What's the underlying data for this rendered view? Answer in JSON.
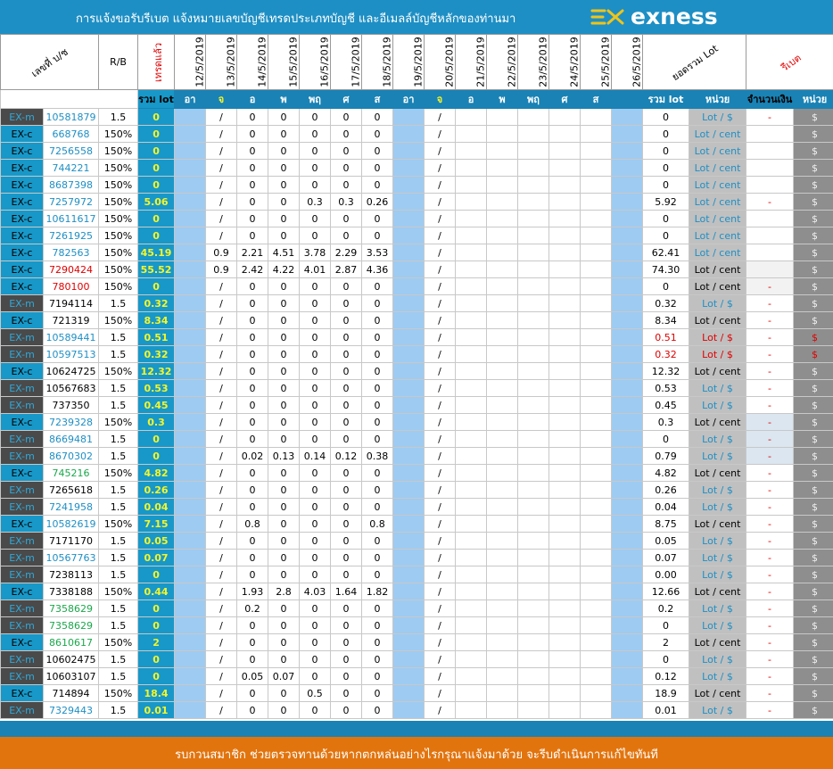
{
  "banner": {
    "title": "การแจ้งขอรับรีเบต   แจ้งหมายเลขบัญชีเทรดประเภทบัญชี และอีเมลล์บัญชีหลักของท่านมา",
    "brand": "exness",
    "logo_icon": "exness-ex-mark-icon"
  },
  "header": {
    "account_label": "เลขที่ บ/ช",
    "rb_label": "R/B",
    "traded_label": "เทรดแล้ว",
    "dates": [
      "12/5/2019",
      "13/5/2019",
      "14/5/2019",
      "15/5/2019",
      "16/5/2019",
      "17/5/2019",
      "18/5/2019",
      "19/5/2019",
      "20/5/2019",
      "21/5/2019",
      "22/5/2019",
      "23/5/2019",
      "24/5/2019",
      "25/5/2019",
      "26/5/2019"
    ],
    "sum_lot_label": "ยอดรวม Lot",
    "rebate_label": "รีเบต"
  },
  "subheader": {
    "total_lot": "รวม lot",
    "days": [
      "อา",
      "จ",
      "อ",
      "พ",
      "พฤ",
      "ศ",
      "ส",
      "อา",
      "จ",
      "อ",
      "พ",
      "พฤ",
      "ศ",
      "ส",
      ""
    ],
    "total_lot2": "รวม lot",
    "unit": "หน่วย",
    "amount": "จำนวนเงิน",
    "unit2": "หน่วย"
  },
  "rows": [
    {
      "type": "EX-m",
      "acc": "10581879",
      "rb": "1.5",
      "total": "0",
      "w1": [
        "/",
        "0",
        "0",
        "0",
        "0",
        "0"
      ],
      "w2": [
        "/"
      ],
      "sum": "0",
      "unit": "Lot / $",
      "amount": "-",
      "cur": "$"
    },
    {
      "type": "EX-c",
      "acc": "668768",
      "rb": "150%",
      "total": "0",
      "w1": [
        "/",
        "0",
        "0",
        "0",
        "0",
        "0"
      ],
      "w2": [
        "/"
      ],
      "sum": "0",
      "unit": "Lot / cent",
      "amount": "",
      "cur": "$"
    },
    {
      "type": "EX-c",
      "acc": "7256558",
      "rb": "150%",
      "total": "0",
      "w1": [
        "/",
        "0",
        "0",
        "0",
        "0",
        "0"
      ],
      "w2": [
        "/"
      ],
      "sum": "0",
      "unit": "Lot / cent",
      "amount": "",
      "cur": "$"
    },
    {
      "type": "EX-c",
      "acc": "744221",
      "rb": "150%",
      "total": "0",
      "w1": [
        "/",
        "0",
        "0",
        "0",
        "0",
        "0"
      ],
      "w2": [
        "/"
      ],
      "sum": "0",
      "unit": "Lot / cent",
      "amount": "",
      "cur": "$"
    },
    {
      "type": "EX-c",
      "acc": "8687398",
      "rb": "150%",
      "total": "0",
      "w1": [
        "/",
        "0",
        "0",
        "0",
        "0",
        "0"
      ],
      "w2": [
        "/"
      ],
      "sum": "0",
      "unit": "Lot / cent",
      "amount": "",
      "cur": "$"
    },
    {
      "type": "EX-c",
      "acc": "7257972",
      "rb": "150%",
      "total": "5.06",
      "w1": [
        "/",
        "0",
        "0",
        "0.3",
        "0.3",
        "0.26"
      ],
      "w2": [
        "/"
      ],
      "sum": "5.92",
      "unit": "Lot / cent",
      "amount": "-",
      "cur": "$"
    },
    {
      "type": "EX-c",
      "acc": "10611617",
      "rb": "150%",
      "total": "0",
      "w1": [
        "/",
        "0",
        "0",
        "0",
        "0",
        "0"
      ],
      "w2": [
        "/"
      ],
      "sum": "0",
      "unit": "Lot / cent",
      "amount": "",
      "cur": "$"
    },
    {
      "type": "EX-c",
      "acc": "7261925",
      "rb": "150%",
      "total": "0",
      "w1": [
        "/",
        "0",
        "0",
        "0",
        "0",
        "0"
      ],
      "w2": [
        "/"
      ],
      "sum": "0",
      "unit": "Lot / cent",
      "amount": "",
      "cur": "$"
    },
    {
      "type": "EX-c",
      "acc": "782563",
      "rb": "150%",
      "total": "45.19",
      "w1": [
        "0.9",
        "2.21",
        "4.51",
        "3.78",
        "2.29",
        "3.53"
      ],
      "w2": [
        "/"
      ],
      "sum": "62.41",
      "unit": "Lot / cent",
      "amount": "",
      "cur": "$"
    },
    {
      "type": "EX-c",
      "acc": "7290424",
      "rb": "150%",
      "total": "55.52",
      "w1": [
        "0.9",
        "2.42",
        "4.22",
        "4.01",
        "2.87",
        "4.36"
      ],
      "w2": [
        "/"
      ],
      "sum": "74.30",
      "unit": "Lot / cent",
      "amount": "",
      "cur": "$"
    },
    {
      "type": "EX-c",
      "acc": "780100",
      "rb": "150%",
      "total": "0",
      "w1": [
        "/",
        "0",
        "0",
        "0",
        "0",
        "0"
      ],
      "w2": [
        "/"
      ],
      "sum": "0",
      "unit": "Lot / cent",
      "amount": "-",
      "cur": "$"
    },
    {
      "type": "EX-m",
      "acc": "7194114",
      "rb": "1.5",
      "total": "0.32",
      "w1": [
        "/",
        "0",
        "0",
        "0",
        "0",
        "0"
      ],
      "w2": [
        "/"
      ],
      "sum": "0.32",
      "unit": "Lot / $",
      "amount": "-",
      "cur": "$"
    },
    {
      "type": "EX-c",
      "acc": "721319",
      "rb": "150%",
      "total": "8.34",
      "w1": [
        "/",
        "0",
        "0",
        "0",
        "0",
        "0"
      ],
      "w2": [
        "/"
      ],
      "sum": "8.34",
      "unit": "Lot / cent",
      "amount": "-",
      "cur": "$"
    },
    {
      "type": "EX-m",
      "acc": "10589441",
      "rb": "1.5",
      "total": "0.51",
      "w1": [
        "/",
        "0",
        "0",
        "0",
        "0",
        "0"
      ],
      "w2": [
        "/"
      ],
      "sum": "0.51",
      "unit": "Lot / $",
      "amount": "-",
      "cur": "$"
    },
    {
      "type": "EX-m",
      "acc": "10597513",
      "rb": "1.5",
      "total": "0.32",
      "w1": [
        "/",
        "0",
        "0",
        "0",
        "0",
        "0"
      ],
      "w2": [
        "/"
      ],
      "sum": "0.32",
      "unit": "Lot / $",
      "amount": "-",
      "cur": "$"
    },
    {
      "type": "EX-c",
      "acc": "10624725",
      "rb": "150%",
      "total": "12.32",
      "w1": [
        "/",
        "0",
        "0",
        "0",
        "0",
        "0"
      ],
      "w2": [
        "/"
      ],
      "sum": "12.32",
      "unit": "Lot / cent",
      "amount": "-",
      "cur": "$"
    },
    {
      "type": "EX-m",
      "acc": "10567683",
      "rb": "1.5",
      "total": "0.53",
      "w1": [
        "/",
        "0",
        "0",
        "0",
        "0",
        "0"
      ],
      "w2": [
        "/"
      ],
      "sum": "0.53",
      "unit": "Lot / $",
      "amount": "-",
      "cur": "$"
    },
    {
      "type": "EX-m",
      "acc": "737350",
      "rb": "1.5",
      "total": "0.45",
      "w1": [
        "/",
        "0",
        "0",
        "0",
        "0",
        "0"
      ],
      "w2": [
        "/"
      ],
      "sum": "0.45",
      "unit": "Lot / $",
      "amount": "-",
      "cur": "$"
    },
    {
      "type": "EX-c",
      "acc": "7239328",
      "rb": "150%",
      "total": "0.3",
      "w1": [
        "/",
        "0",
        "0",
        "0",
        "0",
        "0"
      ],
      "w2": [
        "/"
      ],
      "sum": "0.3",
      "unit": "Lot / cent",
      "amount": "-",
      "cur": "$"
    },
    {
      "type": "EX-m",
      "acc": "8669481",
      "rb": "1.5",
      "total": "0",
      "w1": [
        "/",
        "0",
        "0",
        "0",
        "0",
        "0"
      ],
      "w2": [
        "/"
      ],
      "sum": "0",
      "unit": "Lot / $",
      "amount": "-",
      "cur": "$"
    },
    {
      "type": "EX-m",
      "acc": "8670302",
      "rb": "1.5",
      "total": "0",
      "w1": [
        "/",
        "0.02",
        "0.13",
        "0.14",
        "0.12",
        "0.38"
      ],
      "w2": [
        "/"
      ],
      "sum": "0.79",
      "unit": "Lot / $",
      "amount": "-",
      "cur": "$"
    },
    {
      "type": "EX-c",
      "acc": "745216",
      "rb": "150%",
      "total": "4.82",
      "w1": [
        "/",
        "0",
        "0",
        "0",
        "0",
        "0"
      ],
      "w2": [
        "/"
      ],
      "sum": "4.82",
      "unit": "Lot / cent",
      "amount": "-",
      "cur": "$"
    },
    {
      "type": "EX-m",
      "acc": "7265618",
      "rb": "1.5",
      "total": "0.26",
      "w1": [
        "/",
        "0",
        "0",
        "0",
        "0",
        "0"
      ],
      "w2": [
        "/"
      ],
      "sum": "0.26",
      "unit": "Lot / $",
      "amount": "-",
      "cur": "$"
    },
    {
      "type": "EX-m",
      "acc": "7241958",
      "rb": "1.5",
      "total": "0.04",
      "w1": [
        "/",
        "0",
        "0",
        "0",
        "0",
        "0"
      ],
      "w2": [
        "/"
      ],
      "sum": "0.04",
      "unit": "Lot / $",
      "amount": "-",
      "cur": "$"
    },
    {
      "type": "EX-c",
      "acc": "10582619",
      "rb": "150%",
      "total": "7.15",
      "w1": [
        "/",
        "0.8",
        "0",
        "0",
        "0",
        "0.8"
      ],
      "w2": [
        "/"
      ],
      "sum": "8.75",
      "unit": "Lot / cent",
      "amount": "-",
      "cur": "$"
    },
    {
      "type": "EX-m",
      "acc": "7171170",
      "rb": "1.5",
      "total": "0.05",
      "w1": [
        "/",
        "0",
        "0",
        "0",
        "0",
        "0"
      ],
      "w2": [
        "/"
      ],
      "sum": "0.05",
      "unit": "Lot / $",
      "amount": "-",
      "cur": "$"
    },
    {
      "type": "EX-m",
      "acc": "10567763",
      "rb": "1.5",
      "total": "0.07",
      "w1": [
        "/",
        "0",
        "0",
        "0",
        "0",
        "0"
      ],
      "w2": [
        "/"
      ],
      "sum": "0.07",
      "unit": "Lot / $",
      "amount": "-",
      "cur": "$"
    },
    {
      "type": "EX-m",
      "acc": "7238113",
      "rb": "1.5",
      "total": "0",
      "w1": [
        "/",
        "0",
        "0",
        "0",
        "0",
        "0"
      ],
      "w2": [
        "/"
      ],
      "sum": "0.00",
      "unit": "Lot / $",
      "amount": "-",
      "cur": "$"
    },
    {
      "type": "EX-c",
      "acc": "7338188",
      "rb": "150%",
      "total": "0.44",
      "w1": [
        "/",
        "1.93",
        "2.8",
        "4.03",
        "1.64",
        "1.82"
      ],
      "w2": [
        "/"
      ],
      "sum": "12.66",
      "unit": "Lot / cent",
      "amount": "-",
      "cur": "$"
    },
    {
      "type": "EX-m",
      "acc": "7358629",
      "rb": "1.5",
      "total": "0",
      "w1": [
        "/",
        "0.2",
        "0",
        "0",
        "0",
        "0"
      ],
      "w2": [
        "/"
      ],
      "sum": "0.2",
      "unit": "Lot / $",
      "amount": "-",
      "cur": "$"
    },
    {
      "type": "EX-m",
      "acc": "7358629",
      "rb": "1.5",
      "total": "0",
      "w1": [
        "/",
        "0",
        "0",
        "0",
        "0",
        "0"
      ],
      "w2": [
        "/"
      ],
      "sum": "0",
      "unit": "Lot / $",
      "amount": "-",
      "cur": "$"
    },
    {
      "type": "EX-c",
      "acc": "8610617",
      "rb": "150%",
      "total": "2",
      "w1": [
        "/",
        "0",
        "0",
        "0",
        "0",
        "0"
      ],
      "w2": [
        "/"
      ],
      "sum": "2",
      "unit": "Lot / cent",
      "amount": "-",
      "cur": "$"
    },
    {
      "type": "EX-m",
      "acc": "10602475",
      "rb": "1.5",
      "total": "0",
      "w1": [
        "/",
        "0",
        "0",
        "0",
        "0",
        "0"
      ],
      "w2": [
        "/"
      ],
      "sum": "0",
      "unit": "Lot / $",
      "amount": "-",
      "cur": "$"
    },
    {
      "type": "EX-m",
      "acc": "10603107",
      "rb": "1.5",
      "total": "0",
      "w1": [
        "/",
        "0.05",
        "0.07",
        "0",
        "0",
        "0"
      ],
      "w2": [
        "/"
      ],
      "sum": "0.12",
      "unit": "Lot / $",
      "amount": "-",
      "cur": "$"
    },
    {
      "type": "EX-c",
      "acc": "714894",
      "rb": "150%",
      "total": "18.4",
      "w1": [
        "/",
        "0",
        "0",
        "0.5",
        "0",
        "0"
      ],
      "w2": [
        "/"
      ],
      "sum": "18.9",
      "unit": "Lot / cent",
      "amount": "-",
      "cur": "$"
    },
    {
      "type": "EX-m",
      "acc": "7329443",
      "rb": "1.5",
      "total": "0.01",
      "w1": [
        "/",
        "0",
        "0",
        "0",
        "0",
        "0"
      ],
      "w2": [
        "/"
      ],
      "sum": "0.01",
      "unit": "Lot / $",
      "amount": "-",
      "cur": "$"
    }
  ],
  "styles": {
    "acc_red": [
      9,
      10
    ],
    "acc_dark": [
      11,
      12,
      15,
      16,
      17,
      22,
      25,
      27,
      28,
      32,
      33,
      34
    ],
    "acc_green": [
      21,
      29,
      30,
      31
    ],
    "red_rows": [
      13,
      14
    ],
    "highlight_rows": [
      18,
      19,
      20
    ],
    "gray_rows": [
      9,
      10
    ]
  },
  "footer": {
    "note": "รบกวนสมาชิก ช่วยตรวจทานด้วยหากตกหล่นอย่างไรกรุณาแจ้งมาด้วย จะรีบดำเนินการแก้ไขทันที"
  },
  "colors": {
    "banner": "#1e8fc4",
    "footer": "#e2740e",
    "total_text": "#f5f52a",
    "sunday": "#9ecbf2",
    "red_sunday": "#ff0000"
  }
}
